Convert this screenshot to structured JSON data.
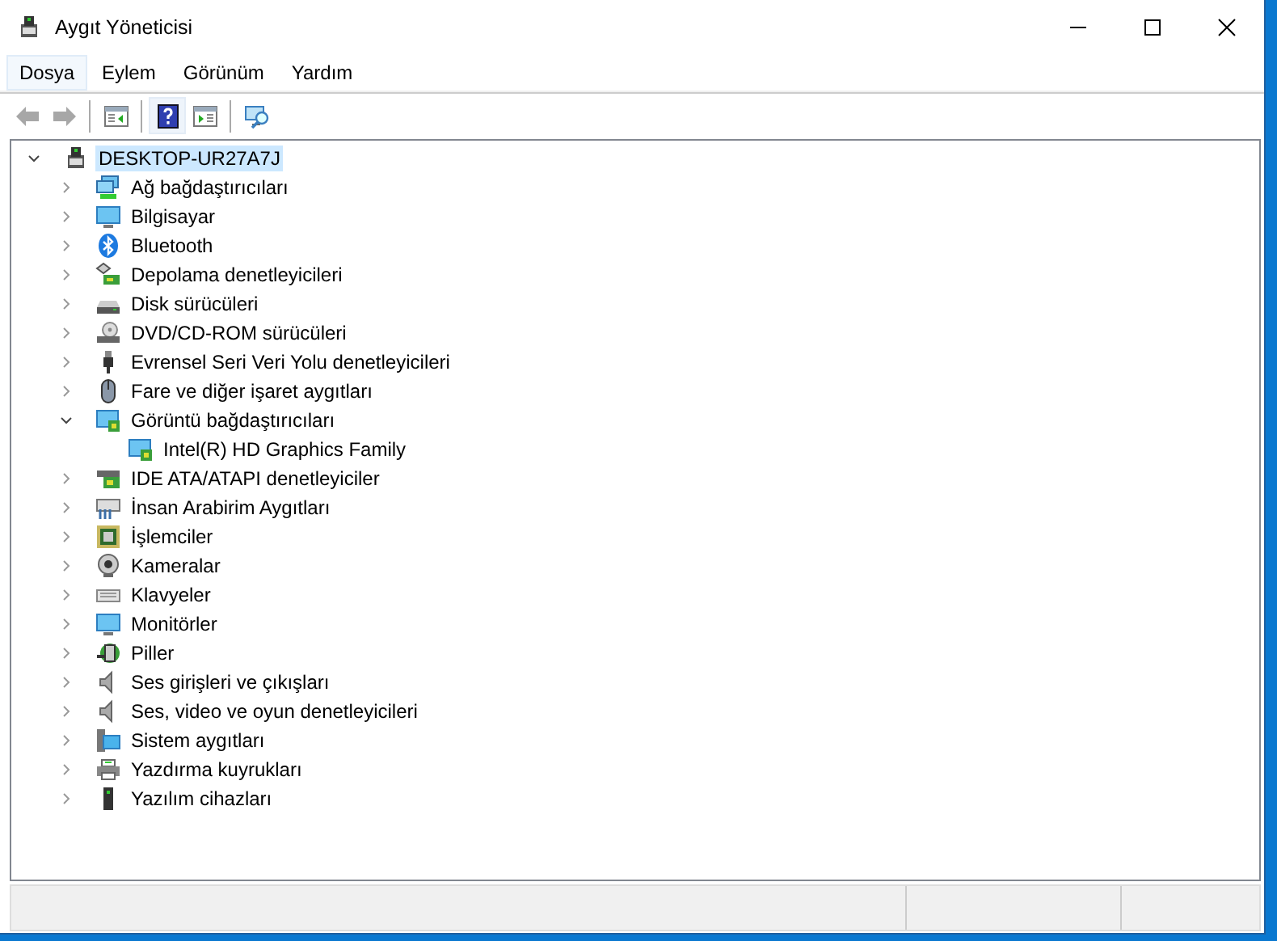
{
  "window": {
    "title": "Aygıt Yöneticisi"
  },
  "menu": [
    {
      "label": "Dosya",
      "selected": true
    },
    {
      "label": "Eylem",
      "selected": false
    },
    {
      "label": "Görünüm",
      "selected": false
    },
    {
      "label": "Yardım",
      "selected": false
    }
  ],
  "toolbar": [
    {
      "kind": "back",
      "disabled": true
    },
    {
      "kind": "forward",
      "disabled": true
    },
    {
      "kind": "sep"
    },
    {
      "kind": "showhide",
      "disabled": false
    },
    {
      "kind": "sep"
    },
    {
      "kind": "help",
      "disabled": false,
      "selected": true
    },
    {
      "kind": "properties",
      "disabled": false,
      "selected": false
    },
    {
      "kind": "sep"
    },
    {
      "kind": "scan",
      "disabled": false,
      "selected": false
    }
  ],
  "tree": {
    "label": "DESKTOP-UR27A7J",
    "expanded": true,
    "selected": true,
    "children": [
      {
        "label": "Ağ bağdaştırıcıları",
        "expanded": false
      },
      {
        "label": "Bilgisayar",
        "expanded": false
      },
      {
        "label": "Bluetooth",
        "expanded": false
      },
      {
        "label": "Depolama denetleyicileri",
        "expanded": false
      },
      {
        "label": "Disk sürücüleri",
        "expanded": false
      },
      {
        "label": "DVD/CD-ROM sürücüleri",
        "expanded": false
      },
      {
        "label": "Evrensel Seri Veri Yolu denetleyicileri",
        "expanded": false
      },
      {
        "label": "Fare ve diğer işaret aygıtları",
        "expanded": false
      },
      {
        "label": "Görüntü bağdaştırıcıları",
        "expanded": true,
        "children": [
          {
            "label": "Intel(R) HD Graphics Family"
          }
        ]
      },
      {
        "label": "IDE ATA/ATAPI denetleyiciler",
        "expanded": false
      },
      {
        "label": "İnsan Arabirim Aygıtları",
        "expanded": false
      },
      {
        "label": "İşlemciler",
        "expanded": false
      },
      {
        "label": "Kameralar",
        "expanded": false
      },
      {
        "label": "Klavyeler",
        "expanded": false
      },
      {
        "label": "Monitörler",
        "expanded": false
      },
      {
        "label": "Piller",
        "expanded": false
      },
      {
        "label": "Ses girişleri ve çıkışları",
        "expanded": false
      },
      {
        "label": "Ses, video ve oyun denetleyicileri",
        "expanded": false
      },
      {
        "label": "Sistem aygıtları",
        "expanded": false
      },
      {
        "label": "Yazdırma kuyrukları",
        "expanded": false
      },
      {
        "label": "Yazılım cihazları",
        "expanded": false
      }
    ]
  }
}
